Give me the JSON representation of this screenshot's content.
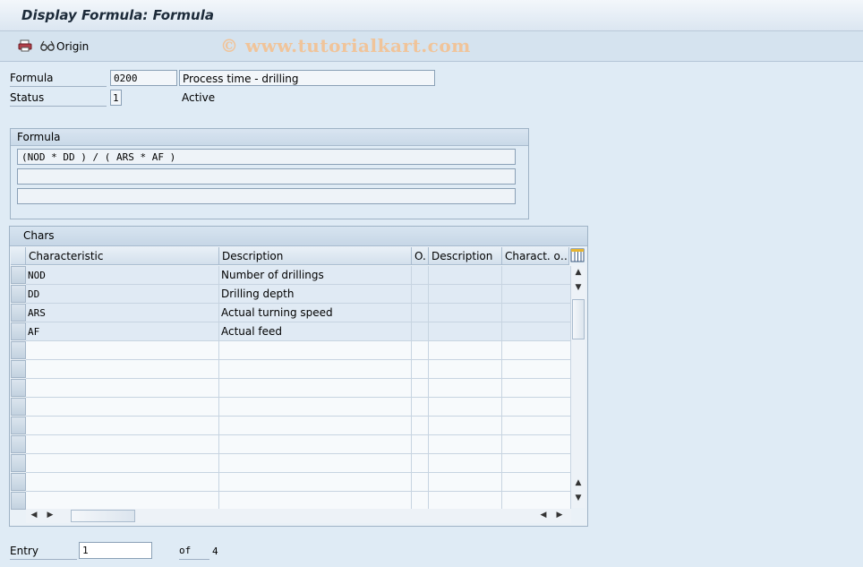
{
  "window": {
    "title": "Display Formula: Formula"
  },
  "toolbar": {
    "origin_label": "Origin",
    "watermark": "© www.tutorialkart.com"
  },
  "header": {
    "formula_label": "Formula",
    "formula_id": "0200",
    "formula_description": "Process time - drilling",
    "status_label": "Status",
    "status_value": "1",
    "status_text": "Active"
  },
  "formula_group": {
    "title": "Formula",
    "lines": [
      "(NOD * DD ) / ( ARS * AF )",
      "",
      ""
    ]
  },
  "chars_table": {
    "title": "Chars",
    "columns": [
      "Characteristic",
      "Description",
      "O.",
      "Description",
      "Charact. o…"
    ],
    "rows": [
      {
        "characteristic": "NOD",
        "description": "Number of drillings"
      },
      {
        "characteristic": "DD",
        "description": "Drilling depth"
      },
      {
        "characteristic": "ARS",
        "description": "Actual turning speed"
      },
      {
        "characteristic": "AF",
        "description": "Actual feed"
      }
    ]
  },
  "footer": {
    "entry_label": "Entry",
    "entry_value": "1",
    "of_label": "of",
    "total": "4"
  },
  "icons": {
    "print": "printer-icon",
    "origin": "glasses-icon",
    "column_config": "column-layout-icon"
  }
}
